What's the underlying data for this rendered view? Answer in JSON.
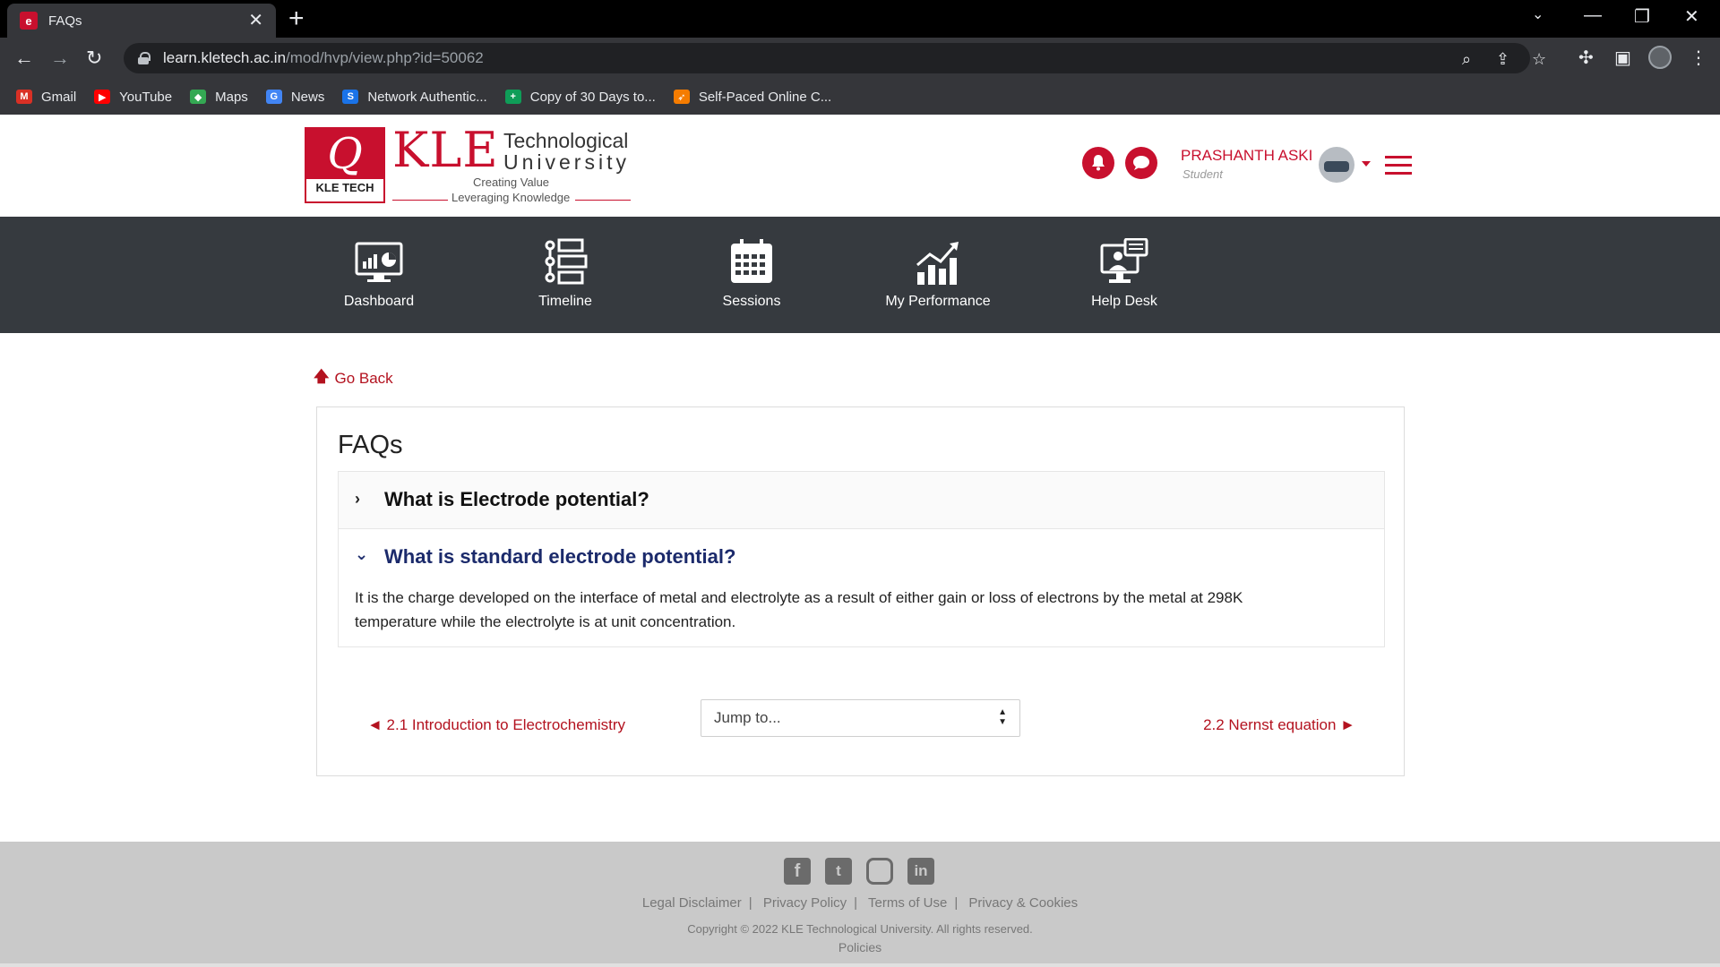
{
  "browser": {
    "tab_title": "FAQs",
    "tab_favicon_text": "e",
    "url_host": "learn.kletech.ac.in",
    "url_path": "/mod/hvp/view.php?id=50062",
    "bookmarks": [
      {
        "label": "Gmail",
        "icon": "gmail-icon",
        "color": "#d93025",
        "glyph": "M"
      },
      {
        "label": "YouTube",
        "icon": "youtube-icon",
        "color": "#ff0000",
        "glyph": "▶"
      },
      {
        "label": "Maps",
        "icon": "maps-icon",
        "color": "#34a853",
        "glyph": "◆"
      },
      {
        "label": "News",
        "icon": "news-icon",
        "color": "#4285f4",
        "glyph": "G"
      },
      {
        "label": "Network Authentic...",
        "icon": "network-icon",
        "color": "#1a73e8",
        "glyph": "S"
      },
      {
        "label": "Copy of 30 Days to...",
        "icon": "sheets-icon",
        "color": "#0f9d58",
        "glyph": "+"
      },
      {
        "label": "Self-Paced Online C...",
        "icon": "course-icon",
        "color": "#f57c00",
        "glyph": "➶"
      }
    ]
  },
  "site": {
    "logo_mark": "Q",
    "logo_tag": "KLE TECH",
    "logo_kle": "KLE",
    "logo_tech": "Technological",
    "logo_univ": "University",
    "logo_creating": "Creating Value",
    "logo_leveraging": "Leveraging Knowledge",
    "user_name": "PRASHANTH ASKI",
    "user_role": "Student",
    "brand_color": "#c8102e"
  },
  "nav": [
    {
      "label": "Dashboard",
      "icon": "dashboard-icon"
    },
    {
      "label": "Timeline",
      "icon": "timeline-icon"
    },
    {
      "label": "Sessions",
      "icon": "calendar-icon"
    },
    {
      "label": "My Performance",
      "icon": "performance-chart-icon"
    },
    {
      "label": "Help Desk",
      "icon": "help-desk-icon"
    }
  ],
  "content": {
    "go_back": "Go Back",
    "title": "FAQs",
    "faqs": [
      {
        "question": "What is Electrode potential?",
        "expanded": false
      },
      {
        "question": "What is standard electrode potential?",
        "expanded": true,
        "answer": "It is the charge developed on the interface of metal and electrolyte as a result of either gain or loss of electrons by the metal at 298K temperature while the electrolyte is at unit concentration."
      }
    ],
    "prev_link": "◄ 2.1 Introduction to Electrochemistry",
    "next_link": "2.2 Nernst equation ►",
    "jump_placeholder": "Jump to..."
  },
  "footer": {
    "social": [
      "facebook-icon",
      "twitter-icon",
      "instagram-icon",
      "linkedin-icon"
    ],
    "links": [
      "Legal Disclaimer",
      "Privacy Policy",
      "Terms of Use",
      "Privacy & Cookies"
    ],
    "copyright": "Copyright © 2022 KLE Technological University. All rights reserved.",
    "policies": "Policies"
  }
}
